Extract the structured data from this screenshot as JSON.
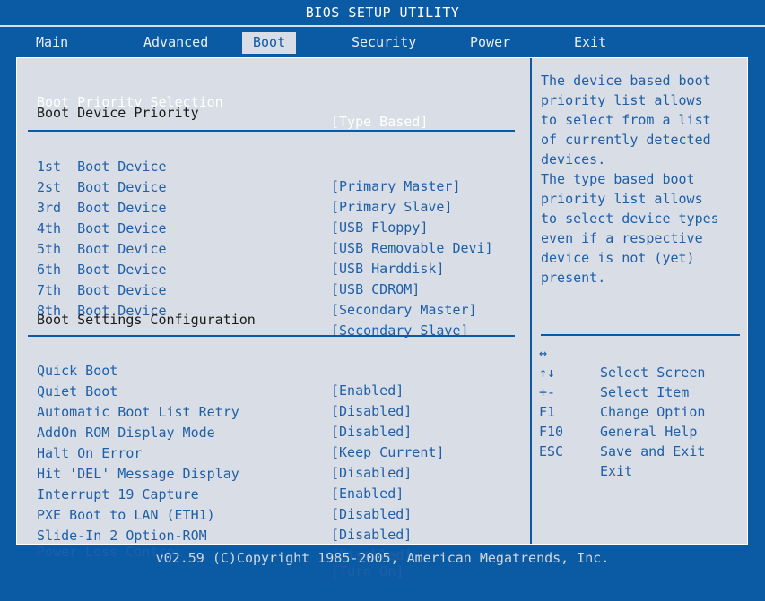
{
  "title": "BIOS SETUP UTILITY",
  "menu": [
    {
      "label": "Main"
    },
    {
      "label": "Advanced"
    },
    {
      "label": "Boot"
    },
    {
      "label": "Security"
    },
    {
      "label": "Power"
    },
    {
      "label": "Exit"
    }
  ],
  "boot_priority": {
    "label": "Boot Priority Selection",
    "value": "[Type Based]"
  },
  "section_device_priority": "Boot Device Priority",
  "devices": [
    {
      "ord": "1st",
      "name": "Boot Device",
      "value": "[Primary Master]"
    },
    {
      "ord": "2st",
      "name": "Boot Device",
      "value": "[Primary Slave]"
    },
    {
      "ord": "3rd",
      "name": "Boot Device",
      "value": "[USB Floppy]"
    },
    {
      "ord": "4th",
      "name": "Boot Device",
      "value": "[USB Removable Devi]"
    },
    {
      "ord": "5th",
      "name": "Boot Device",
      "value": "[USB Harddisk]"
    },
    {
      "ord": "6th",
      "name": "Boot Device",
      "value": "[USB CDROM]"
    },
    {
      "ord": "7th",
      "name": "Boot Device",
      "value": "[Secondary Master]"
    },
    {
      "ord": "8th",
      "name": "Boot Device",
      "value": "[Secondary Slave]"
    }
  ],
  "section_settings": "Boot Settings Configuration",
  "settings": [
    {
      "label": "Quick Boot",
      "value": "[Enabled]"
    },
    {
      "label": "Quiet Boot",
      "value": "[Disabled]"
    },
    {
      "label": "Automatic Boot List Retry",
      "value": "[Disabled]"
    },
    {
      "label": "AddOn ROM Display Mode",
      "value": "[Keep Current]"
    },
    {
      "label": "Halt On Error",
      "value": "[Disabled]"
    },
    {
      "label": "Hit 'DEL' Message Display",
      "value": "[Enabled]"
    },
    {
      "label": "Interrupt 19 Capture",
      "value": "[Disabled]"
    },
    {
      "label": "PXE Boot to LAN (ETH1)",
      "value": "[Disabled]"
    },
    {
      "label": "Slide-In 2 Option-ROM",
      "value": "[Disabled]"
    },
    {
      "label": "Power Loss Control",
      "value": "[Turn On]"
    }
  ],
  "help_text": "The device based boot\npriority list allows\nto select from a list\nof currently detected\ndevices.\nThe type based boot\npriority list allows\nto select device types\neven if a respective\ndevice is not (yet)\npresent.",
  "keys": [
    {
      "key": "↔",
      "desc": "Select Screen"
    },
    {
      "key": "↑↓",
      "desc": "Select Item"
    },
    {
      "key": "+-",
      "desc": "Change Option"
    },
    {
      "key": "F1",
      "desc": "General Help"
    },
    {
      "key": "F10",
      "desc": "Save and Exit"
    },
    {
      "key": "ESC",
      "desc": "Exit"
    }
  ],
  "footer": "v02.59 (C)Copyright 1985-2005, American Megatrends, Inc."
}
